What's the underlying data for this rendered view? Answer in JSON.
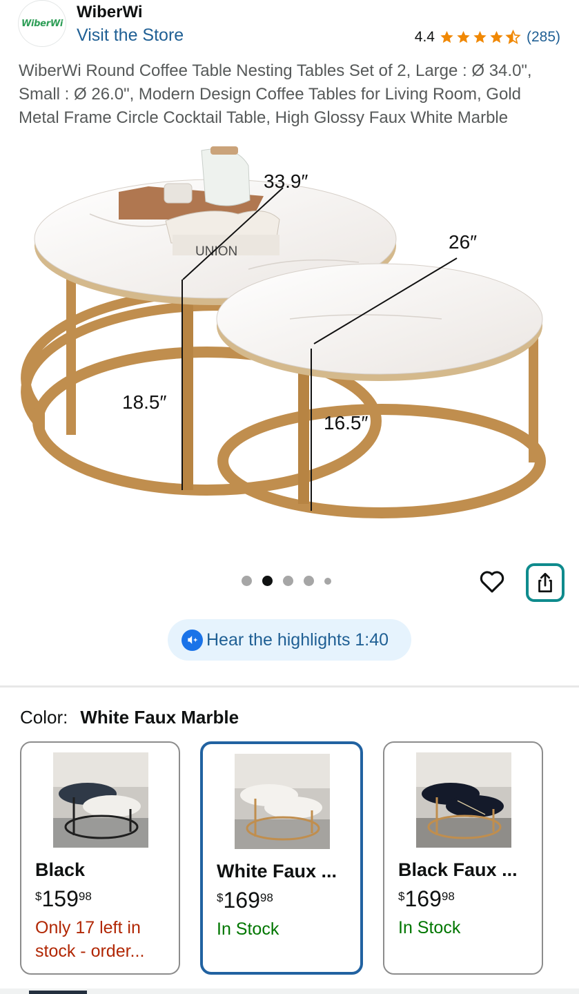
{
  "store": {
    "logo_text": "WiberWi",
    "brand": "WiberWi",
    "visit_link": "Visit the Store",
    "rating_value": "4.4",
    "rating_stars": 4.4,
    "rating_count": "(285)",
    "star_color": "#f08804"
  },
  "product": {
    "title": "WiberWi Round Coffee Table Nesting Tables Set of 2, Large : Ø 34.0\", Small : Ø 26.0\", Modern Design Coffee Tables for Living Room, Gold Metal Frame Circle Cocktail Table, High Glossy Faux White Marble"
  },
  "image": {
    "dimension_large_diameter": "33.9″",
    "dimension_small_diameter": "26″",
    "dimension_large_height": "18.5″",
    "dimension_small_height": "16.5″",
    "book_text": "UNION",
    "frame_color": "#c08e4e",
    "marble_color": "#f4f1ee"
  },
  "gallery": {
    "dot_count": 5,
    "active_index": 1
  },
  "actions": {
    "heart_icon": "heart-outline-icon",
    "share_icon": "share-icon",
    "accent_color": "#0f8b8d"
  },
  "audio": {
    "label": "Hear the highlights 1:40",
    "icon": "audio-sparkle-icon"
  },
  "color_selector": {
    "label": "Color:",
    "selected": "White Faux Marble",
    "variants": [
      {
        "name": "Black",
        "price_currency": "$",
        "price_whole": "159",
        "price_fraction": "98",
        "stock": "Only 17 left in stock - order...",
        "stock_type": "low",
        "selected": false
      },
      {
        "name": "White Faux ...",
        "price_currency": "$",
        "price_whole": "169",
        "price_fraction": "98",
        "stock": "In Stock",
        "stock_type": "in",
        "selected": true
      },
      {
        "name": "Black Faux ...",
        "price_currency": "$",
        "price_whole": "169",
        "price_fraction": "98",
        "stock": "In Stock",
        "stock_type": "in",
        "selected": false
      }
    ]
  }
}
